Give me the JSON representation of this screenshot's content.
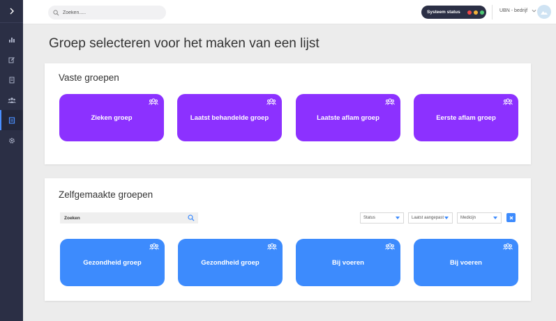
{
  "topbar": {
    "search_placeholder": "Zoeken.....",
    "system_status_label": "Systeem status",
    "status_colors": [
      "#f04848",
      "#f3b33a",
      "#4cc873"
    ],
    "company_name": "UBN - bedrijf"
  },
  "sidebar": {
    "items": [
      {
        "icon": "bar-chart-icon",
        "active": false
      },
      {
        "icon": "edit-icon",
        "active": false
      },
      {
        "icon": "document-icon",
        "active": false
      },
      {
        "icon": "users-icon",
        "active": false
      },
      {
        "icon": "list-icon",
        "active": true
      },
      {
        "icon": "gear-icon",
        "active": false
      }
    ]
  },
  "page": {
    "title": "Groep selecteren voor het maken van een lijst"
  },
  "fixed_groups": {
    "title": "Vaste groepen",
    "cards": [
      {
        "label": "Zieken groep"
      },
      {
        "label": "Laatst behandelde groep"
      },
      {
        "label": "Laatste aflam groep"
      },
      {
        "label": "Eerste aflam groep"
      }
    ]
  },
  "custom_groups": {
    "title": "Zelfgemaakte groepen",
    "search_placeholder": "Zoeken",
    "filters": {
      "status": "Status",
      "last_modified": "Laatst aangepast",
      "medicine": "Medicijn"
    },
    "cards": [
      {
        "label": "Gezondheid groep"
      },
      {
        "label": "Gezondheid groep"
      },
      {
        "label": "Bij voeren"
      },
      {
        "label": "Bij voeren"
      }
    ]
  },
  "colors": {
    "sidebar": "#2b2f45",
    "fixed_card": "#8c31ff",
    "custom_card": "#3d8bfd",
    "accent": "#3d8bfd"
  }
}
